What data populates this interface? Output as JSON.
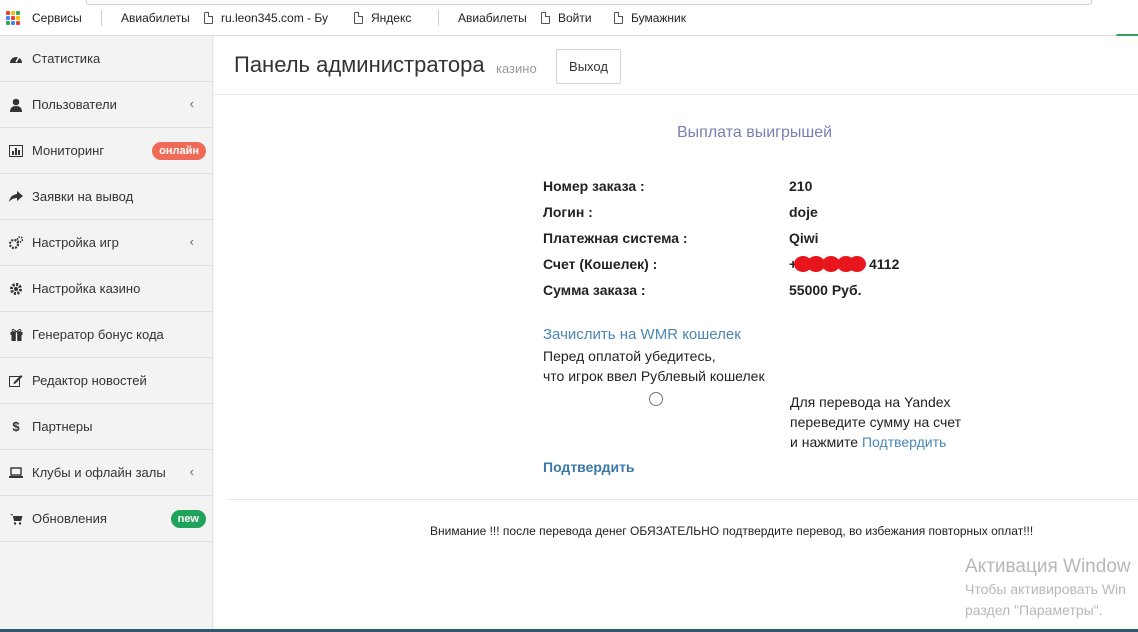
{
  "bookmarks": {
    "items": [
      {
        "label": "Сервисы",
        "icon": "apps-grid-icon"
      },
      {
        "label": "Авиабилеты",
        "icon": "document-icon"
      },
      {
        "label": "ru.leon345.com - Бу",
        "icon": "document-icon"
      },
      {
        "label": "Яндекс",
        "icon": "document-icon"
      },
      {
        "label": "Авиабилеты",
        "icon": "document-icon"
      },
      {
        "label": "Войти",
        "icon": "document-icon"
      },
      {
        "label": "Бумажник",
        "icon": "document-icon"
      }
    ]
  },
  "sidebar": {
    "items": [
      {
        "label": "Статистика",
        "icon": "dashboard-icon"
      },
      {
        "label": "Пользователи",
        "icon": "user-icon",
        "chevron": "‹"
      },
      {
        "label": "Мониторинг",
        "icon": "bar-chart-icon",
        "badge": "онлайн",
        "badge_color": "#ef6b57"
      },
      {
        "label": "Заявки на вывод",
        "icon": "share-arrow-icon"
      },
      {
        "label": "Настройка игр",
        "icon": "gears-icon",
        "chevron": "‹"
      },
      {
        "label": "Настройка казино",
        "icon": "gear-icon"
      },
      {
        "label": "Генератор бонус кода",
        "icon": "gift-icon"
      },
      {
        "label": "Редактор новостей",
        "icon": "edit-icon"
      },
      {
        "label": "Партнеры",
        "icon": "dollar-icon"
      },
      {
        "label": "Клубы и офлайн залы",
        "icon": "laptop-icon",
        "chevron": "‹"
      },
      {
        "label": "Обновления",
        "icon": "cart-icon",
        "badge": "new",
        "badge_color": "#1fa35a"
      }
    ]
  },
  "header": {
    "title": "Панель администратора",
    "subtitle": "казино",
    "logout_label": "Выход"
  },
  "payout": {
    "title": "Выплата выигрышей",
    "rows": [
      {
        "label": "Номер заказа :",
        "value": "210"
      },
      {
        "label": "Логин :",
        "value": "doje"
      },
      {
        "label": "Платежная система :",
        "value": "Qiwi"
      },
      {
        "label": "Счет (Кошелек) :",
        "value_prefix": "+",
        "value_suffix": "4112"
      },
      {
        "label": "Сумма заказа :",
        "value": "55000 Руб."
      }
    ],
    "wmr_link": "Зачислить на WMR кошелек",
    "wmr_note_1": "Перед оплатой убедитесь,",
    "wmr_note_2": "что игрок ввел Рублевый кошелек",
    "yandex_note_1": "Для перевода на Yandex",
    "yandex_note_2": "переведите сумму на счет",
    "yandex_note_3_prefix": "и нажмите",
    "yandex_note_3_link": "Подтвердить",
    "confirm_label": "Подтвердить",
    "warning": "Внимание !!! после перевода денег ОБЯЗАТЕЛЬНО подтвердите перевод, во избежания повторных оплат!!!"
  },
  "activation": {
    "title": "Активация Window",
    "line1": "Чтобы активировать Win",
    "line2": "раздел \"Параметры\"."
  },
  "colors": {
    "accent": "#7b7fb0",
    "link": "#4a86b5",
    "redaction": "#e8151c"
  }
}
